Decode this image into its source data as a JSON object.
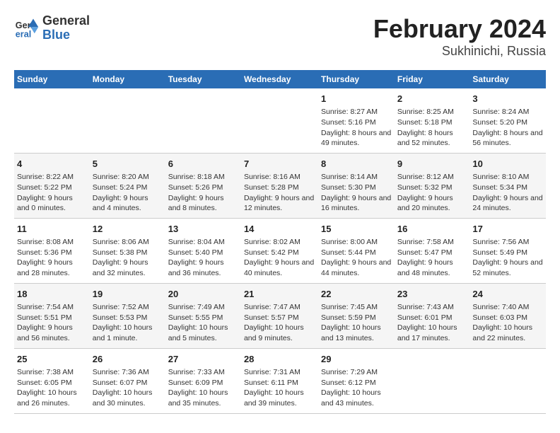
{
  "header": {
    "logo": {
      "general": "General",
      "blue": "Blue"
    },
    "title": "February 2024",
    "subtitle": "Sukhinichi, Russia"
  },
  "columns": [
    "Sunday",
    "Monday",
    "Tuesday",
    "Wednesday",
    "Thursday",
    "Friday",
    "Saturday"
  ],
  "weeks": [
    [
      null,
      null,
      null,
      null,
      {
        "day": "1",
        "sunrise": "Sunrise: 8:27 AM",
        "sunset": "Sunset: 5:16 PM",
        "daylight": "Daylight: 8 hours and 49 minutes."
      },
      {
        "day": "2",
        "sunrise": "Sunrise: 8:25 AM",
        "sunset": "Sunset: 5:18 PM",
        "daylight": "Daylight: 8 hours and 52 minutes."
      },
      {
        "day": "3",
        "sunrise": "Sunrise: 8:24 AM",
        "sunset": "Sunset: 5:20 PM",
        "daylight": "Daylight: 8 hours and 56 minutes."
      }
    ],
    [
      {
        "day": "4",
        "sunrise": "Sunrise: 8:22 AM",
        "sunset": "Sunset: 5:22 PM",
        "daylight": "Daylight: 9 hours and 0 minutes."
      },
      {
        "day": "5",
        "sunrise": "Sunrise: 8:20 AM",
        "sunset": "Sunset: 5:24 PM",
        "daylight": "Daylight: 9 hours and 4 minutes."
      },
      {
        "day": "6",
        "sunrise": "Sunrise: 8:18 AM",
        "sunset": "Sunset: 5:26 PM",
        "daylight": "Daylight: 9 hours and 8 minutes."
      },
      {
        "day": "7",
        "sunrise": "Sunrise: 8:16 AM",
        "sunset": "Sunset: 5:28 PM",
        "daylight": "Daylight: 9 hours and 12 minutes."
      },
      {
        "day": "8",
        "sunrise": "Sunrise: 8:14 AM",
        "sunset": "Sunset: 5:30 PM",
        "daylight": "Daylight: 9 hours and 16 minutes."
      },
      {
        "day": "9",
        "sunrise": "Sunrise: 8:12 AM",
        "sunset": "Sunset: 5:32 PM",
        "daylight": "Daylight: 9 hours and 20 minutes."
      },
      {
        "day": "10",
        "sunrise": "Sunrise: 8:10 AM",
        "sunset": "Sunset: 5:34 PM",
        "daylight": "Daylight: 9 hours and 24 minutes."
      }
    ],
    [
      {
        "day": "11",
        "sunrise": "Sunrise: 8:08 AM",
        "sunset": "Sunset: 5:36 PM",
        "daylight": "Daylight: 9 hours and 28 minutes."
      },
      {
        "day": "12",
        "sunrise": "Sunrise: 8:06 AM",
        "sunset": "Sunset: 5:38 PM",
        "daylight": "Daylight: 9 hours and 32 minutes."
      },
      {
        "day": "13",
        "sunrise": "Sunrise: 8:04 AM",
        "sunset": "Sunset: 5:40 PM",
        "daylight": "Daylight: 9 hours and 36 minutes."
      },
      {
        "day": "14",
        "sunrise": "Sunrise: 8:02 AM",
        "sunset": "Sunset: 5:42 PM",
        "daylight": "Daylight: 9 hours and 40 minutes."
      },
      {
        "day": "15",
        "sunrise": "Sunrise: 8:00 AM",
        "sunset": "Sunset: 5:44 PM",
        "daylight": "Daylight: 9 hours and 44 minutes."
      },
      {
        "day": "16",
        "sunrise": "Sunrise: 7:58 AM",
        "sunset": "Sunset: 5:47 PM",
        "daylight": "Daylight: 9 hours and 48 minutes."
      },
      {
        "day": "17",
        "sunrise": "Sunrise: 7:56 AM",
        "sunset": "Sunset: 5:49 PM",
        "daylight": "Daylight: 9 hours and 52 minutes."
      }
    ],
    [
      {
        "day": "18",
        "sunrise": "Sunrise: 7:54 AM",
        "sunset": "Sunset: 5:51 PM",
        "daylight": "Daylight: 9 hours and 56 minutes."
      },
      {
        "day": "19",
        "sunrise": "Sunrise: 7:52 AM",
        "sunset": "Sunset: 5:53 PM",
        "daylight": "Daylight: 10 hours and 1 minute."
      },
      {
        "day": "20",
        "sunrise": "Sunrise: 7:49 AM",
        "sunset": "Sunset: 5:55 PM",
        "daylight": "Daylight: 10 hours and 5 minutes."
      },
      {
        "day": "21",
        "sunrise": "Sunrise: 7:47 AM",
        "sunset": "Sunset: 5:57 PM",
        "daylight": "Daylight: 10 hours and 9 minutes."
      },
      {
        "day": "22",
        "sunrise": "Sunrise: 7:45 AM",
        "sunset": "Sunset: 5:59 PM",
        "daylight": "Daylight: 10 hours and 13 minutes."
      },
      {
        "day": "23",
        "sunrise": "Sunrise: 7:43 AM",
        "sunset": "Sunset: 6:01 PM",
        "daylight": "Daylight: 10 hours and 17 minutes."
      },
      {
        "day": "24",
        "sunrise": "Sunrise: 7:40 AM",
        "sunset": "Sunset: 6:03 PM",
        "daylight": "Daylight: 10 hours and 22 minutes."
      }
    ],
    [
      {
        "day": "25",
        "sunrise": "Sunrise: 7:38 AM",
        "sunset": "Sunset: 6:05 PM",
        "daylight": "Daylight: 10 hours and 26 minutes."
      },
      {
        "day": "26",
        "sunrise": "Sunrise: 7:36 AM",
        "sunset": "Sunset: 6:07 PM",
        "daylight": "Daylight: 10 hours and 30 minutes."
      },
      {
        "day": "27",
        "sunrise": "Sunrise: 7:33 AM",
        "sunset": "Sunset: 6:09 PM",
        "daylight": "Daylight: 10 hours and 35 minutes."
      },
      {
        "day": "28",
        "sunrise": "Sunrise: 7:31 AM",
        "sunset": "Sunset: 6:11 PM",
        "daylight": "Daylight: 10 hours and 39 minutes."
      },
      {
        "day": "29",
        "sunrise": "Sunrise: 7:29 AM",
        "sunset": "Sunset: 6:12 PM",
        "daylight": "Daylight: 10 hours and 43 minutes."
      },
      null,
      null
    ]
  ]
}
